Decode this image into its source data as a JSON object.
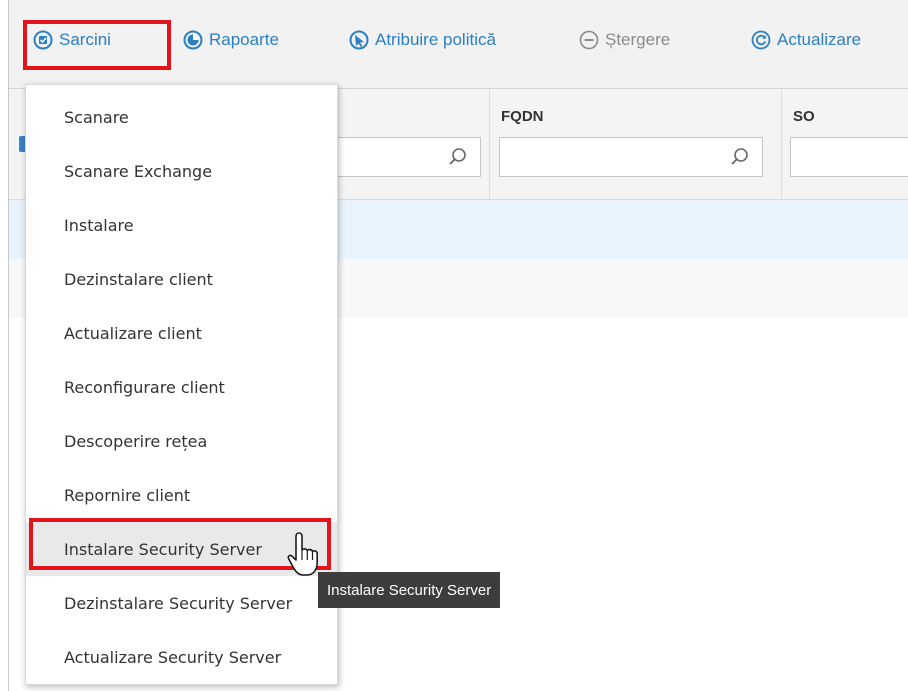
{
  "toolbar": {
    "items": [
      {
        "label": "Sarcini",
        "icon": "tasks-icon"
      },
      {
        "label": "Rapoarte",
        "icon": "reports-icon"
      },
      {
        "label": "Atribuire politică",
        "icon": "policy-assign-icon"
      },
      {
        "label": "Ștergere",
        "icon": "minus-circle-icon",
        "disabled": true
      },
      {
        "label": "Actualizare",
        "icon": "refresh-icon"
      }
    ],
    "accent_color": "#2b7fc3",
    "highlight_color": "#e4141b"
  },
  "grid": {
    "columns": [
      {
        "title": ""
      },
      {
        "title": "FQDN"
      },
      {
        "title": "SO"
      }
    ]
  },
  "menu": {
    "items": [
      {
        "label": "Scanare"
      },
      {
        "label": "Scanare Exchange"
      },
      {
        "label": "Instalare"
      },
      {
        "label": "Dezinstalare client"
      },
      {
        "label": "Actualizare client"
      },
      {
        "label": "Reconfigurare client"
      },
      {
        "label": "Descoperire rețea"
      },
      {
        "label": "Repornire client"
      },
      {
        "label": "Instalare Security Server",
        "hovered": true
      },
      {
        "label": "Dezinstalare Security Server"
      },
      {
        "label": "Actualizare Security Server"
      }
    ]
  },
  "tooltip": {
    "text": "Instalare Security Server"
  }
}
